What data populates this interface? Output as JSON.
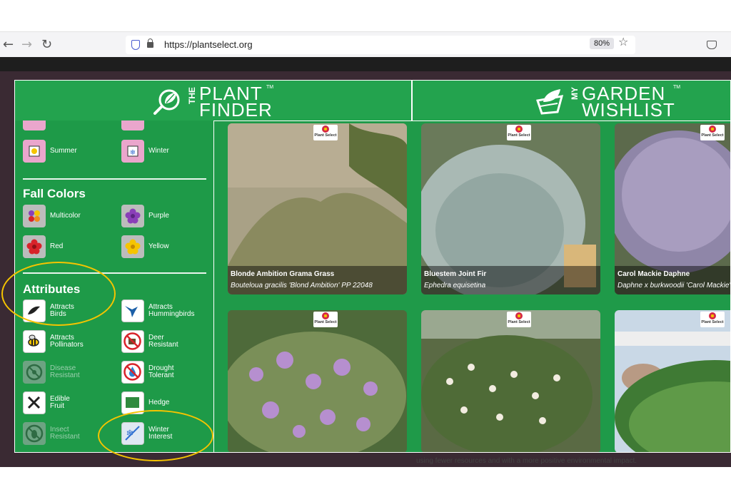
{
  "browser": {
    "url": "https://plantselect.org",
    "zoom": "80%",
    "back_glyph": "←",
    "forward_glyph": "→",
    "reload_glyph": "↻",
    "star_glyph": "☆"
  },
  "header": {
    "finder_small": "THE",
    "finder_top": "PLANT",
    "finder_bottom": "FINDER",
    "wishlist_small": "MY",
    "wishlist_top": "GARDEN",
    "wishlist_bottom": "WISHLIST",
    "tm": "TM"
  },
  "sidebar": {
    "season_options": [
      {
        "label": "Summer",
        "icon": "sun-icon"
      },
      {
        "label": "Winter",
        "icon": "snowflake-icon"
      }
    ],
    "fall_colors_title": "Fall Colors",
    "fall_colors": [
      {
        "label": "Multicolor",
        "icon": "multicolor-flower-icon"
      },
      {
        "label": "Purple",
        "icon": "purple-flower-icon",
        "color": "#8a3fb8"
      },
      {
        "label": "Red",
        "icon": "red-flower-icon",
        "color": "#d8232a"
      },
      {
        "label": "Yellow",
        "icon": "yellow-flower-icon",
        "color": "#f5c400"
      }
    ],
    "attributes_title": "Attributes",
    "attributes": [
      {
        "label": "Attracts\nBirds",
        "icon": "bird-icon"
      },
      {
        "label": "Attracts\nHummingbirds",
        "icon": "hummingbird-icon"
      },
      {
        "label": "Attracts\nPollinators",
        "icon": "bee-icon"
      },
      {
        "label": "Deer\nResistant",
        "icon": "no-deer-icon"
      },
      {
        "label": "Disease\nResistant",
        "icon": "biohazard-icon"
      },
      {
        "label": "Drought\nTolerant",
        "icon": "no-water-icon"
      },
      {
        "label": "Edible\nFruit",
        "icon": "fork-knife-icon"
      },
      {
        "label": "Hedge",
        "icon": "hedge-icon"
      },
      {
        "label": "Insect\nResistant",
        "icon": "no-insect-icon"
      },
      {
        "label": "Winter\nInterest",
        "icon": "snowflake-icon"
      }
    ]
  },
  "plants": [
    {
      "name": "Blonde Ambition Grama Grass",
      "scientific": "Bouteloua gracilis 'Blond Ambition' PP 22048"
    },
    {
      "name": "Bluestem Joint Fir",
      "scientific": "Ephedra equisetina"
    },
    {
      "name": "Carol Mackie Daphne",
      "scientific": "Daphne x burkwoodii 'Carol Mackie'"
    },
    {
      "name": "",
      "scientific": ""
    },
    {
      "name": "",
      "scientific": ""
    },
    {
      "name": "",
      "scientific": ""
    }
  ],
  "badge_text": "Plant Select",
  "background_text": "using fewer resources and with a more positive environmental impact."
}
